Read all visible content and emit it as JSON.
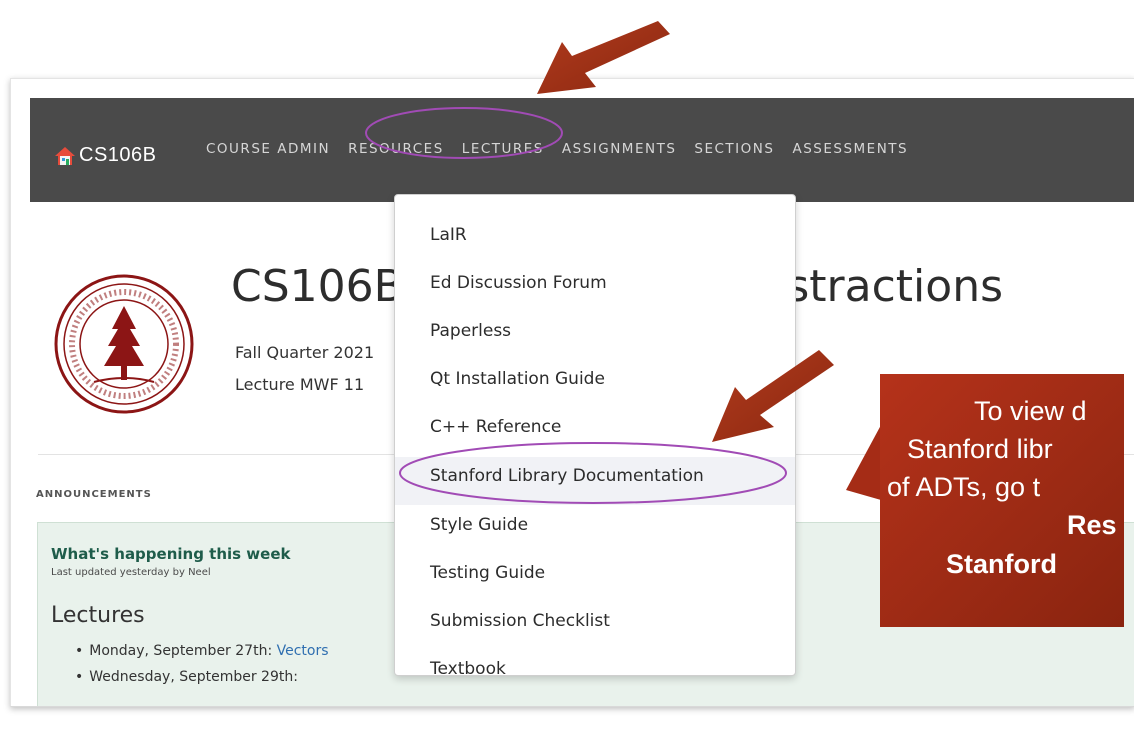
{
  "navbar": {
    "brand": "CS106B",
    "links": [
      "COURSE ADMIN",
      "RESOURCES",
      "LECTURES",
      "ASSIGNMENTS",
      "SECTIONS",
      "ASSESSMENTS"
    ]
  },
  "hero": {
    "title": "CS106B Programming Abstractions",
    "subtitle": "Fall Quarter 2021",
    "lecture": "Lecture MWF 11"
  },
  "announcements": {
    "label": "ANNOUNCEMENTS",
    "card_title": "What's happening this week",
    "updated": "Last updated yesterday by Neel",
    "heading": "Lectures",
    "items": [
      {
        "prefix": "Monday, September 27th: ",
        "link": "Vectors"
      },
      {
        "prefix": "Wednesday, September 29th:",
        "link": ""
      }
    ]
  },
  "dropdown": {
    "items": [
      "LaIR",
      "Ed Discussion Forum",
      "Paperless",
      "Qt Installation Guide",
      "C++ Reference",
      "Stanford Library Documentation",
      "Style Guide",
      "Testing Guide",
      "Submission Checklist",
      "Textbook"
    ],
    "highlighted_index": 5
  },
  "callout": {
    "lines": [
      "To view d",
      "Stanford libr",
      "of ADTs, go t",
      "Res",
      "Stanford"
    ]
  },
  "colors": {
    "navbar": "#4a4a4a",
    "annotation_arrow": "#9b2a14",
    "annotation_ellipse": "#a14bb5",
    "callout": "#a52c16",
    "seal": "#8c1515"
  }
}
